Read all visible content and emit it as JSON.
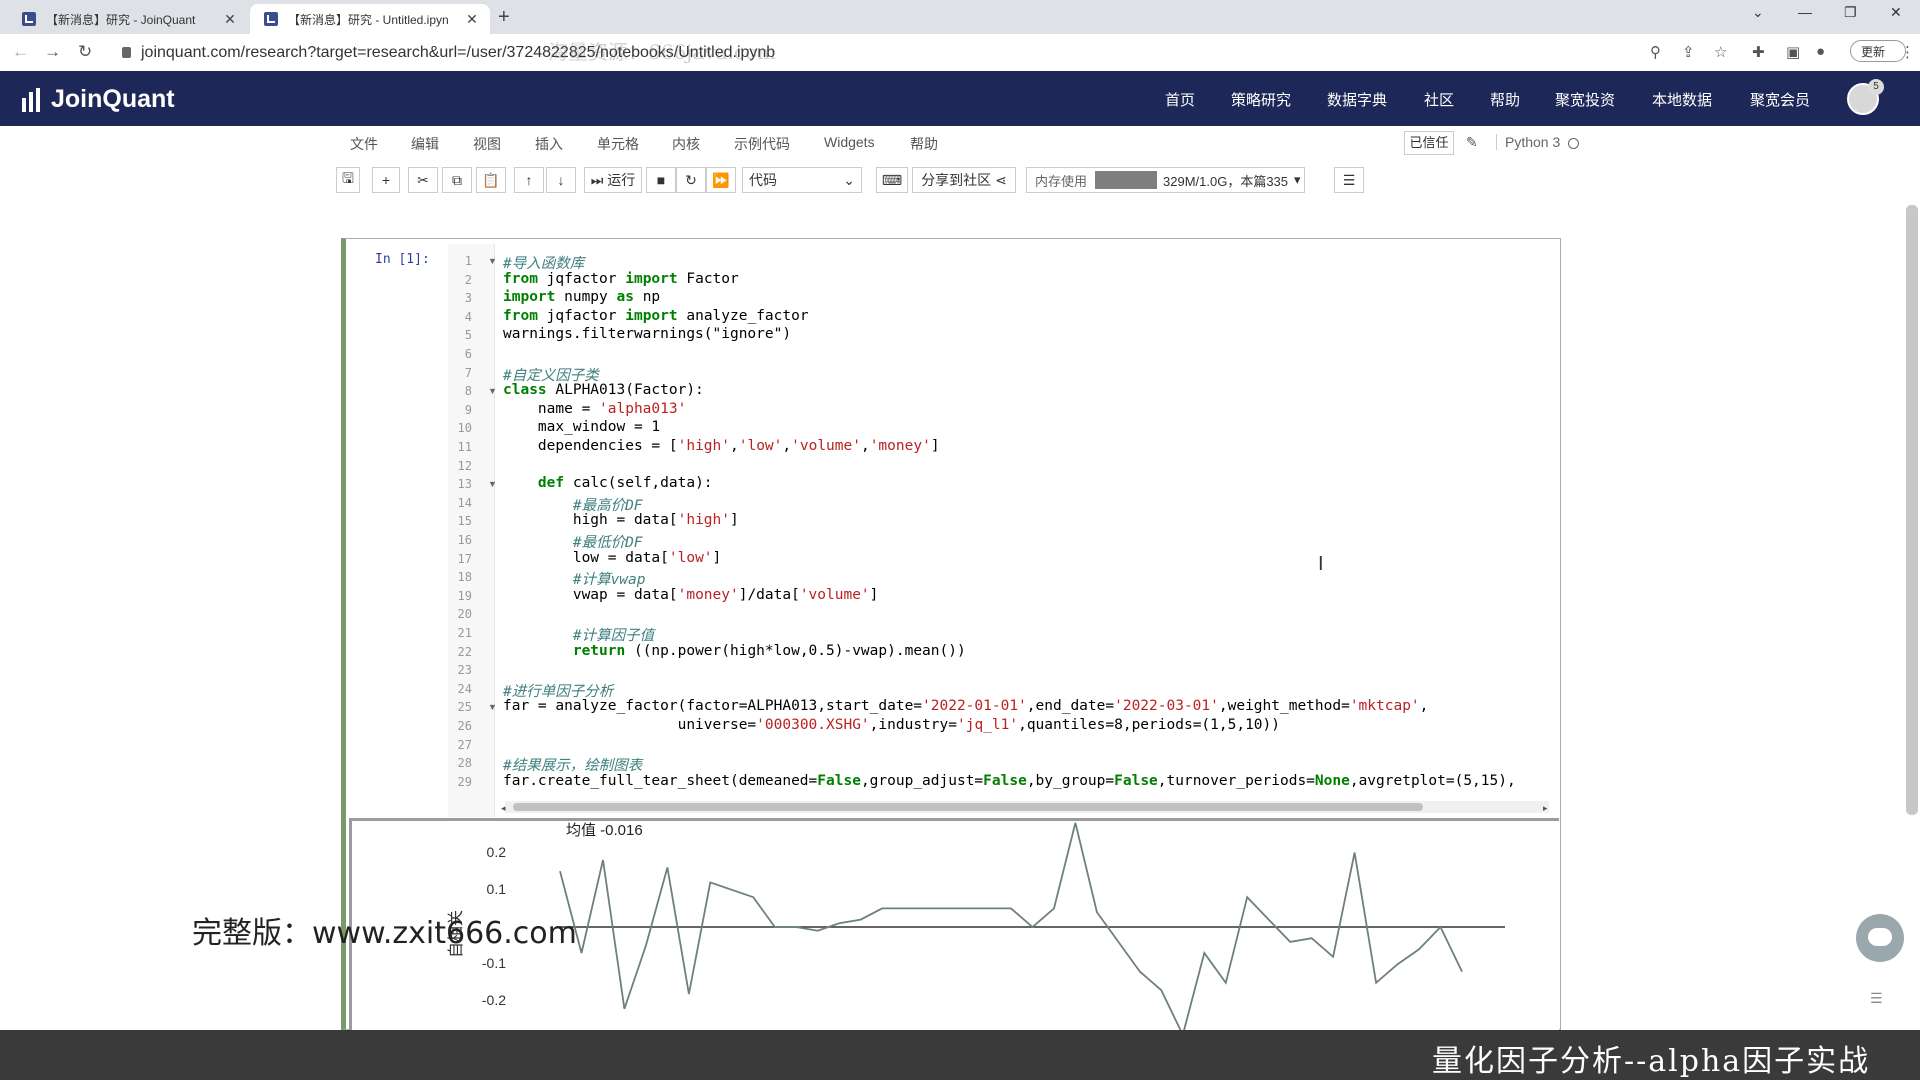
{
  "browser": {
    "tabs": [
      {
        "title": "【新消息】研究 - JoinQuant",
        "active": false
      },
      {
        "title": "【新消息】研究 - Untitled.ipyn",
        "active": true
      }
    ],
    "url": "joinquant.com/research?target=research&url=/user/3724822825/notebooks/Untitled.ipynb",
    "url_watermark": "海量资源：666java.com",
    "update_label": "更新"
  },
  "site": {
    "logo": "JoinQuant",
    "nav": [
      "首页",
      "策略研究",
      "数据字典",
      "社区",
      "帮助",
      "聚宽投资",
      "本地数据",
      "聚宽会员"
    ],
    "notification_count": "5"
  },
  "notebook": {
    "menu": [
      "文件",
      "编辑",
      "视图",
      "插入",
      "单元格",
      "内核",
      "示例代码",
      "Widgets",
      "帮助"
    ],
    "trusted": "已信任",
    "kernel": "Python 3",
    "toolbar": {
      "run_label": "运行",
      "cell_type": "代码",
      "share_label": "分享到社区",
      "memory_label": "内存使用",
      "memory_value": "329M/1.0G，本篇335"
    },
    "prompt": "In  [1]:"
  },
  "code_lines": [
    {
      "n": "1",
      "fold": true,
      "parts": [
        {
          "t": "#导入函数库",
          "c": "cm"
        }
      ]
    },
    {
      "n": "2",
      "parts": [
        {
          "t": "from",
          "c": "kw"
        },
        {
          "t": " jqfactor "
        },
        {
          "t": "import",
          "c": "kw"
        },
        {
          "t": " Factor"
        }
      ]
    },
    {
      "n": "3",
      "parts": [
        {
          "t": "import",
          "c": "kw"
        },
        {
          "t": " numpy "
        },
        {
          "t": "as",
          "c": "kw"
        },
        {
          "t": " np"
        }
      ]
    },
    {
      "n": "4",
      "parts": [
        {
          "t": "from",
          "c": "kw"
        },
        {
          "t": " jqfactor "
        },
        {
          "t": "import",
          "c": "kw"
        },
        {
          "t": " analyze_factor"
        }
      ]
    },
    {
      "n": "5",
      "parts": [
        {
          "t": "warnings.filterwarnings(\"ignore\")"
        }
      ]
    },
    {
      "n": "6",
      "parts": []
    },
    {
      "n": "7",
      "parts": [
        {
          "t": "#自定义因子类",
          "c": "cm"
        }
      ]
    },
    {
      "n": "8",
      "fold": true,
      "parts": [
        {
          "t": "class",
          "c": "kw"
        },
        {
          "t": " ALPHA013(Factor):"
        }
      ]
    },
    {
      "n": "9",
      "parts": [
        {
          "t": "    name = "
        },
        {
          "t": "'alpha013'",
          "c": "st"
        }
      ]
    },
    {
      "n": "10",
      "parts": [
        {
          "t": "    max_window = 1"
        }
      ]
    },
    {
      "n": "11",
      "parts": [
        {
          "t": "    dependencies = ["
        },
        {
          "t": "'high'",
          "c": "st"
        },
        {
          "t": ","
        },
        {
          "t": "'low'",
          "c": "st"
        },
        {
          "t": ","
        },
        {
          "t": "'volume'",
          "c": "st"
        },
        {
          "t": ","
        },
        {
          "t": "'money'",
          "c": "st"
        },
        {
          "t": "]"
        }
      ]
    },
    {
      "n": "12",
      "parts": []
    },
    {
      "n": "13",
      "fold": true,
      "parts": [
        {
          "t": "    "
        },
        {
          "t": "def",
          "c": "kw"
        },
        {
          "t": " calc(self,data):"
        }
      ]
    },
    {
      "n": "14",
      "parts": [
        {
          "t": "        "
        },
        {
          "t": "#最高价DF",
          "c": "cm"
        }
      ]
    },
    {
      "n": "15",
      "parts": [
        {
          "t": "        high = data["
        },
        {
          "t": "'high'",
          "c": "st"
        },
        {
          "t": "]"
        }
      ]
    },
    {
      "n": "16",
      "parts": [
        {
          "t": "        "
        },
        {
          "t": "#最低价DF",
          "c": "cm"
        }
      ]
    },
    {
      "n": "17",
      "parts": [
        {
          "t": "        low = data["
        },
        {
          "t": "'low'",
          "c": "st"
        },
        {
          "t": "]"
        }
      ]
    },
    {
      "n": "18",
      "parts": [
        {
          "t": "        "
        },
        {
          "t": "#计算vwap",
          "c": "cm"
        }
      ]
    },
    {
      "n": "19",
      "parts": [
        {
          "t": "        vwap = data["
        },
        {
          "t": "'money'",
          "c": "st"
        },
        {
          "t": "]/data["
        },
        {
          "t": "'volume'",
          "c": "st"
        },
        {
          "t": "]"
        }
      ]
    },
    {
      "n": "20",
      "parts": []
    },
    {
      "n": "21",
      "parts": [
        {
          "t": "        "
        },
        {
          "t": "#计算因子值",
          "c": "cm"
        }
      ]
    },
    {
      "n": "22",
      "parts": [
        {
          "t": "        "
        },
        {
          "t": "return",
          "c": "kw"
        },
        {
          "t": " ((np.power(high*low,0.5)-vwap).mean())"
        }
      ]
    },
    {
      "n": "23",
      "parts": []
    },
    {
      "n": "24",
      "parts": [
        {
          "t": "#进行单因子分析",
          "c": "cm"
        }
      ]
    },
    {
      "n": "25",
      "fold": true,
      "parts": [
        {
          "t": "far = analyze_factor(factor=ALPHA013,start_date="
        },
        {
          "t": "'2022-01-01'",
          "c": "st"
        },
        {
          "t": ",end_date="
        },
        {
          "t": "'2022-03-01'",
          "c": "st"
        },
        {
          "t": ",weight_method="
        },
        {
          "t": "'mktcap'",
          "c": "st"
        },
        {
          "t": ","
        }
      ]
    },
    {
      "n": "26",
      "parts": [
        {
          "t": "                    universe="
        },
        {
          "t": "'000300.XSHG'",
          "c": "st"
        },
        {
          "t": ",industry="
        },
        {
          "t": "'jq_l1'",
          "c": "st"
        },
        {
          "t": ",quantiles=8,periods=(1,5,10))"
        }
      ]
    },
    {
      "n": "27",
      "parts": []
    },
    {
      "n": "28",
      "parts": [
        {
          "t": "#结果展示，绘制图表",
          "c": "cm"
        }
      ]
    },
    {
      "n": "29",
      "parts": [
        {
          "t": "far.create_full_tear_sheet(demeaned="
        },
        {
          "t": "False",
          "c": "kw"
        },
        {
          "t": ",group_adjust="
        },
        {
          "t": "False",
          "c": "kw"
        },
        {
          "t": ",by_group="
        },
        {
          "t": "False",
          "c": "kw"
        },
        {
          "t": ",turnover_periods="
        },
        {
          "t": "None",
          "c": "kw"
        },
        {
          "t": ",avgretplot=(5,15),"
        }
      ]
    }
  ],
  "chart_data": {
    "type": "line",
    "annotation": "均值 -0.016",
    "ylabel": "自相关",
    "ytick_labels": [
      "0.2",
      "0.1",
      "-0.1",
      "-0.2"
    ],
    "ylim": [
      -0.28,
      0.28
    ],
    "y": [
      0.15,
      -0.07,
      0.18,
      -0.22,
      -0.05,
      0.16,
      -0.18,
      0.12,
      0.1,
      0.08,
      0.0,
      0.0,
      -0.01,
      0.01,
      0.02,
      0.05,
      0.05,
      0.05,
      0.05,
      0.05,
      0.05,
      0.05,
      0.0,
      0.05,
      0.28,
      0.04,
      -0.04,
      -0.12,
      -0.17,
      -0.29,
      -0.07,
      -0.15,
      0.08,
      0.02,
      -0.04,
      -0.03,
      -0.08,
      0.2,
      -0.15,
      -0.1,
      -0.06,
      0.0,
      -0.12
    ]
  },
  "overlays": {
    "promo": "完整版：www.zxit666.com",
    "subtitle": "量化因子分析--alpha因子实战"
  }
}
